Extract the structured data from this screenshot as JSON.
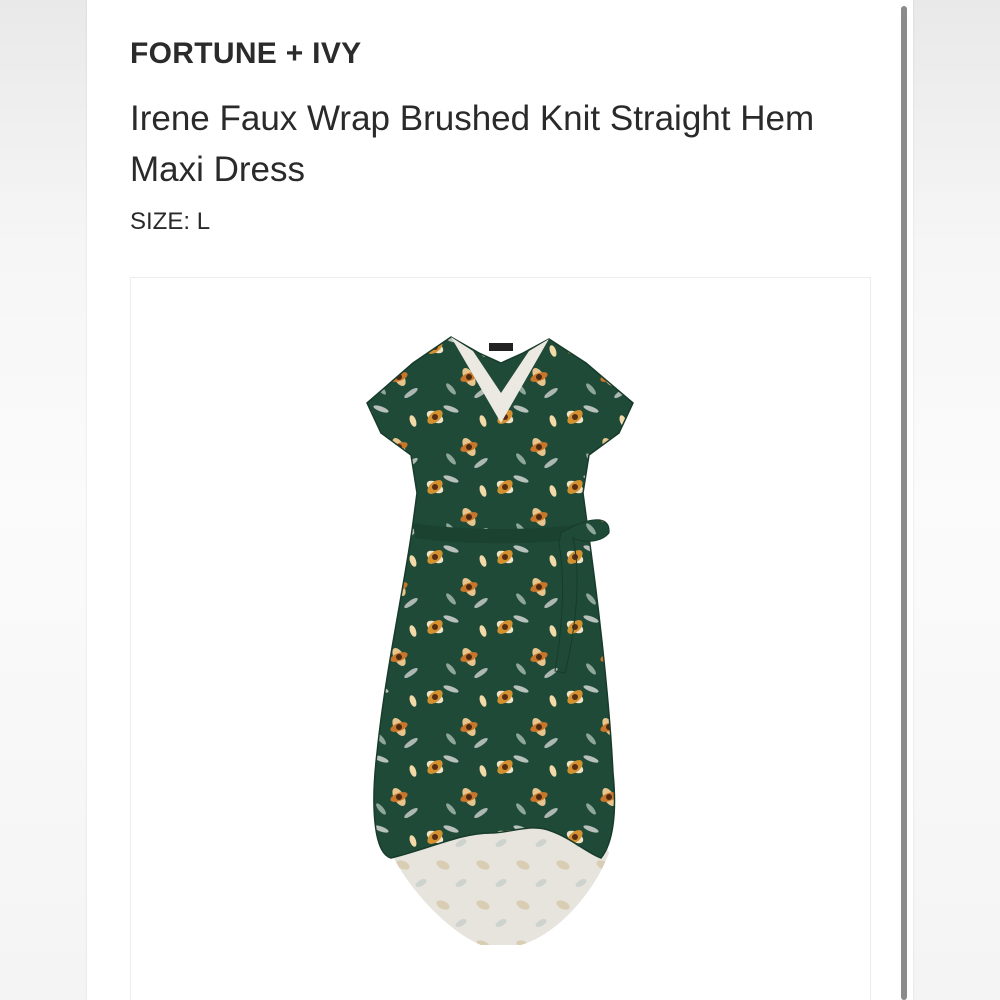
{
  "product": {
    "brand": "FORTUNE + IVY",
    "name": "Irene Faux Wrap Brushed Knit Straight Hem Maxi Dress",
    "size_label": "SIZE:",
    "size_value": "L"
  },
  "image": {
    "subject": "product-photo-dress",
    "colors": {
      "dress_base": "#1f4a37",
      "lining": "#e6e4dd",
      "flower_orange": "#d4912f",
      "flower_cream": "#efe3c8",
      "leaf_gray": "#b9c1bd"
    }
  },
  "colors": {
    "text": "#2a2a2a",
    "card": "#ffffff",
    "scrollbar": "#8b8b8b"
  }
}
